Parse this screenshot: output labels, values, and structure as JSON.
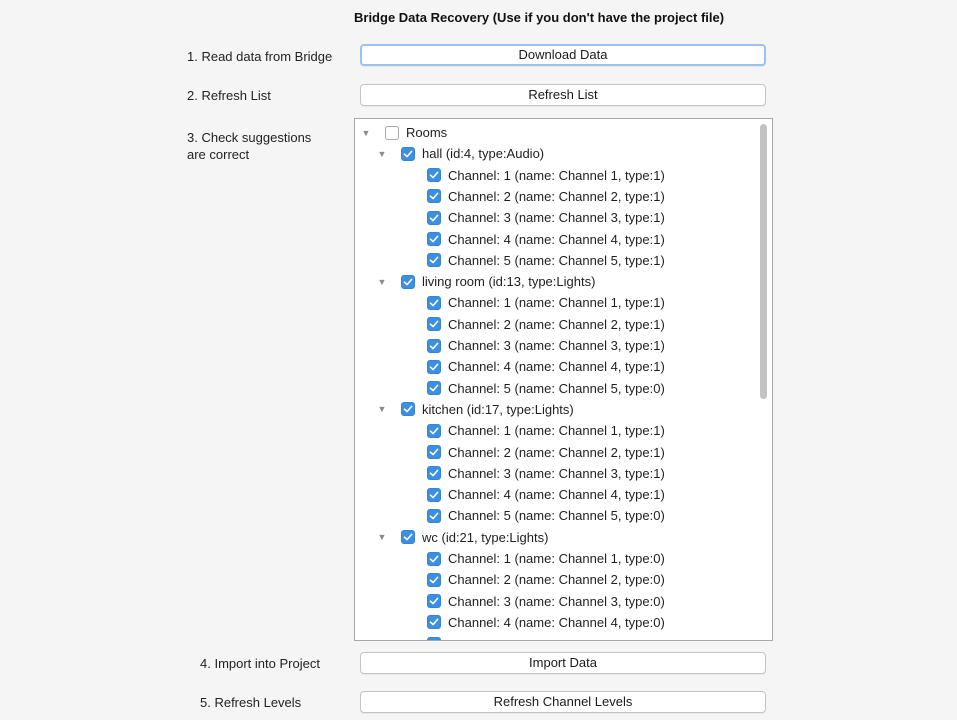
{
  "title": "Bridge Data Recovery (Use if you don't have the project file)",
  "steps": {
    "read": {
      "label": "1. Read data from Bridge",
      "button": "Download Data"
    },
    "refresh": {
      "label": "2. Refresh List",
      "button": "Refresh List"
    },
    "check": {
      "label_line1": "3. Check suggestions",
      "label_line2": "are correct"
    },
    "import": {
      "label": "4. Import into Project",
      "button": "Import Data"
    },
    "levels": {
      "label": "5. Refresh Levels",
      "button": "Refresh Channel Levels"
    }
  },
  "tree": {
    "root": {
      "label": "Rooms",
      "checked": false
    },
    "rooms": [
      {
        "label": "hall (id:4, type:Audio)",
        "checked": true,
        "channels": [
          "Channel: 1 (name: Channel 1, type:1)",
          "Channel: 2 (name: Channel 2, type:1)",
          "Channel: 3 (name: Channel 3, type:1)",
          "Channel: 4 (name: Channel 4, type:1)",
          "Channel: 5 (name: Channel 5, type:1)"
        ]
      },
      {
        "label": "living room (id:13, type:Lights)",
        "checked": true,
        "channels": [
          "Channel: 1 (name: Channel 1, type:1)",
          "Channel: 2 (name: Channel 2, type:1)",
          "Channel: 3 (name: Channel 3, type:1)",
          "Channel: 4 (name: Channel 4, type:1)",
          "Channel: 5 (name: Channel 5, type:0)"
        ]
      },
      {
        "label": "kitchen (id:17, type:Lights)",
        "checked": true,
        "channels": [
          "Channel: 1 (name: Channel 1, type:1)",
          "Channel: 2 (name: Channel 2, type:1)",
          "Channel: 3 (name: Channel 3, type:1)",
          "Channel: 4 (name: Channel 4, type:1)",
          "Channel: 5 (name: Channel 5, type:0)"
        ]
      },
      {
        "label": "wc (id:21, type:Lights)",
        "checked": true,
        "channels": [
          "Channel: 1 (name: Channel 1, type:0)",
          "Channel: 2 (name: Channel 2, type:0)",
          "Channel: 3 (name: Channel 3, type:0)",
          "Channel: 4 (name: Channel 4, type:0)"
        ]
      }
    ]
  },
  "colors": {
    "accent": "#3d8fe0",
    "focus_ring": "#9cc3ee"
  }
}
